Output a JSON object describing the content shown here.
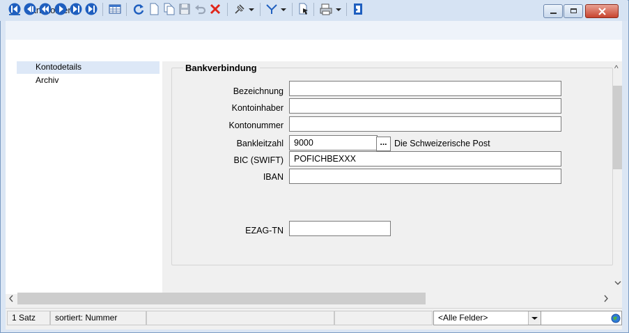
{
  "window": {
    "title": "Bankkonten"
  },
  "toolbar": {
    "icons": [
      "first-record-icon",
      "previous-page-icon",
      "previous-record-icon",
      "next-record-icon",
      "next-page-icon",
      "last-record-icon",
      "table-view-icon",
      "refresh-icon",
      "new-record-icon",
      "copy-record-icon",
      "save-icon",
      "undo-icon",
      "delete-icon",
      "pin-icon",
      "pin-dropdown-icon",
      "filter-icon",
      "filter-dropdown-icon",
      "export-icon",
      "print-icon",
      "print-dropdown-icon",
      "close-form-icon"
    ]
  },
  "nav": {
    "items": [
      {
        "label": "Kontodetails",
        "selected": true
      },
      {
        "label": "Archiv",
        "selected": false
      }
    ]
  },
  "form": {
    "group_title": "Bankverbindung",
    "fields": {
      "bezeichnung": {
        "label": "Bezeichnung",
        "value": ""
      },
      "kontoinhaber": {
        "label": "Kontoinhaber",
        "value": ""
      },
      "kontonummer": {
        "label": "Kontonummer",
        "value": ""
      },
      "bankleitzahl": {
        "label": "Bankleitzahl",
        "value": "9000",
        "lookup_button": "...",
        "bank_name": "Die Schweizerische Post"
      },
      "bic": {
        "label": "BIC (SWIFT)",
        "value": "POFICHBEXXX"
      },
      "iban": {
        "label": "IBAN",
        "value": ""
      },
      "ezag": {
        "label": "EZAG-TN",
        "value": ""
      }
    }
  },
  "status": {
    "count": "1 Satz",
    "sort": "sortiert: Nummer",
    "field_filter": "<Alle Felder>"
  },
  "colors": {
    "accent": "#1f5fbf",
    "title_bg": "#d6e3f3",
    "close_red": "#c8442f"
  }
}
